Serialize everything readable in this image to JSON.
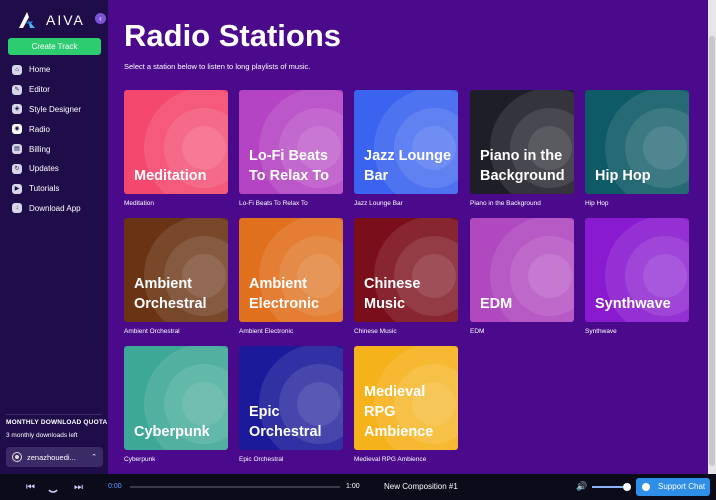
{
  "app": {
    "name": "AIVA"
  },
  "sidebar": {
    "create_label": "Create Track",
    "items": [
      {
        "label": "Home",
        "icon": "home-icon",
        "glyph": "⌂"
      },
      {
        "label": "Editor",
        "icon": "editor-icon",
        "glyph": "✎"
      },
      {
        "label": "Style Designer",
        "icon": "style-designer-icon",
        "glyph": "◈"
      },
      {
        "label": "Radio",
        "icon": "radio-icon",
        "glyph": "◉"
      },
      {
        "label": "Billing",
        "icon": "billing-icon",
        "glyph": "▤"
      },
      {
        "label": "Updates",
        "icon": "updates-icon",
        "glyph": "↻"
      },
      {
        "label": "Tutorials",
        "icon": "tutorials-icon",
        "glyph": "▶"
      },
      {
        "label": "Download App",
        "icon": "download-icon",
        "glyph": "↓"
      }
    ],
    "active": "Radio",
    "quota_title": "MONTHLY DOWNLOAD QUOTA",
    "quota_text": "3 monthly downloads left",
    "username": "zenazhouedi..."
  },
  "main": {
    "title": "Radio Stations",
    "subtitle": "Select a station below to listen to long playlists of music."
  },
  "stations": [
    {
      "title": "Meditation",
      "label": "Meditation",
      "color": "#f4486e"
    },
    {
      "title": "Lo-Fi Beats To Relax To",
      "label": "Lo-Fi Beats To Relax To",
      "color": "#b544c4"
    },
    {
      "title": "Jazz Lounge Bar",
      "label": "Jazz Lounge Bar",
      "color": "#3a64f0"
    },
    {
      "title": "Piano in the Background",
      "label": "Piano in the Background",
      "color": "#1e1e28"
    },
    {
      "title": "Hip Hop",
      "label": "Hip Hop",
      "color": "#0e5a66"
    },
    {
      "title": "Ambient Orchestral",
      "label": "Ambient Orchestral",
      "color": "#6a3414"
    },
    {
      "title": "Ambient Electronic",
      "label": "Ambient Electronic",
      "color": "#e0701e"
    },
    {
      "title": "Chinese Music",
      "label": "Chinese Music",
      "color": "#7a0e1a"
    },
    {
      "title": "EDM",
      "label": "EDM",
      "color": "#b048c0"
    },
    {
      "title": "Synthwave",
      "label": "Synthwave",
      "color": "#8a1ad0"
    },
    {
      "title": "Cyberpunk",
      "label": "Cyberpunk",
      "color": "#3ea896"
    },
    {
      "title": "Epic Orchestral",
      "label": "Epic Orchestral",
      "color": "#1a1a9a"
    },
    {
      "title": "Medieval RPG Ambience",
      "label": "Medieval RPG Ambience",
      "color": "#f6b21a"
    }
  ],
  "player": {
    "time_current": "0:00",
    "time_total": "1:00",
    "composition": "New Composition #1",
    "support_label": "Support Chat"
  }
}
